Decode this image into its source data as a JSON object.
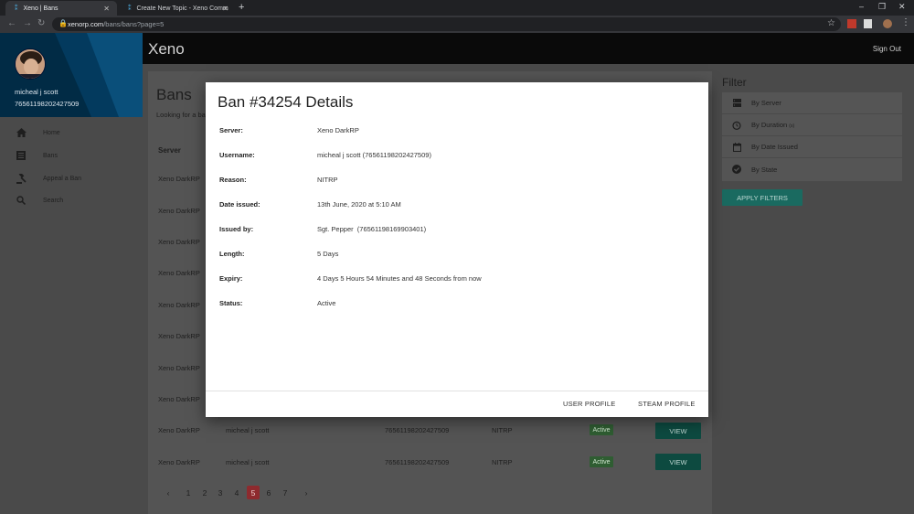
{
  "browser": {
    "tabs": [
      {
        "title": "Xeno | Bans"
      },
      {
        "title": "Create New Topic - Xeno Comm"
      }
    ],
    "url_host": "xenorp.com",
    "url_path": "/bans/bans?page=5"
  },
  "app": {
    "brand": "Xeno",
    "sign_out": "Sign Out"
  },
  "user": {
    "name": "micheal j scott",
    "steam_id": "76561198202427509"
  },
  "sidebar": {
    "items": [
      {
        "label": "Home",
        "icon": "home-icon"
      },
      {
        "label": "Bans",
        "icon": "list-icon"
      },
      {
        "label": "Appeal a Ban",
        "icon": "gavel-icon"
      },
      {
        "label": "Search",
        "icon": "search-icon"
      }
    ]
  },
  "page": {
    "title": "Bans",
    "subtitle": "Looking for a ba",
    "column_server": "Server",
    "rows": [
      {
        "server": "Xeno DarkRP"
      },
      {
        "server": "Xeno DarkRP"
      },
      {
        "server": "Xeno DarkRP"
      },
      {
        "server": "Xeno DarkRP"
      },
      {
        "server": "Xeno DarkRP"
      },
      {
        "server": "Xeno DarkRP"
      },
      {
        "server": "Xeno DarkRP"
      },
      {
        "server": "Xeno DarkRP"
      },
      {
        "server": "Xeno DarkRP",
        "username": "micheal j scott",
        "steam_id": "76561198202427509",
        "reason": "NITRP",
        "status": "Active",
        "action": "VIEW"
      },
      {
        "server": "Xeno DarkRP",
        "username": "micheal j scott",
        "steam_id": "76561198202427509",
        "reason": "NITRP",
        "status": "Active",
        "action": "VIEW"
      }
    ],
    "pagination": {
      "prev": "‹",
      "pages": [
        "1",
        "2",
        "3",
        "4",
        "5",
        "6",
        "7"
      ],
      "current": "5",
      "next": "›"
    }
  },
  "filter": {
    "title": "Filter",
    "items": [
      {
        "label": "By Server",
        "icon": "server-icon"
      },
      {
        "label": "By Duration",
        "suffix": "(s)",
        "icon": "clock-icon"
      },
      {
        "label": "By Date Issued",
        "icon": "calendar-icon"
      },
      {
        "label": "By State",
        "icon": "check-circle-icon"
      }
    ],
    "apply": "APPLY FILTERS"
  },
  "modal": {
    "title": "Ban #34254 Details",
    "details": [
      {
        "label": "Server:",
        "value": "Xeno DarkRP"
      },
      {
        "label": "Username:",
        "value": "micheal j scott (76561198202427509)"
      },
      {
        "label": "Reason:",
        "value": "NITRP"
      },
      {
        "label": "Date issued:",
        "value": "13th June, 2020 at 5:10 AM"
      },
      {
        "label": "Issued by:",
        "value": "Sgt. Pepper  (76561198169903401)"
      },
      {
        "label": "Length:",
        "value": "5 Days"
      },
      {
        "label": "Expiry:",
        "value": "4 Days 5 Hours 54 Minutes and 48 Seconds from now"
      },
      {
        "label": "Status:",
        "value": "Active"
      }
    ],
    "user_profile": "USER PROFILE",
    "steam_profile": "STEAM PROFILE"
  },
  "colors": {
    "accent_teal": "#1a6a60",
    "active_badge": "#2f5d32",
    "current_page": "#8e2a2e",
    "sidebar_header": "#012b45"
  }
}
